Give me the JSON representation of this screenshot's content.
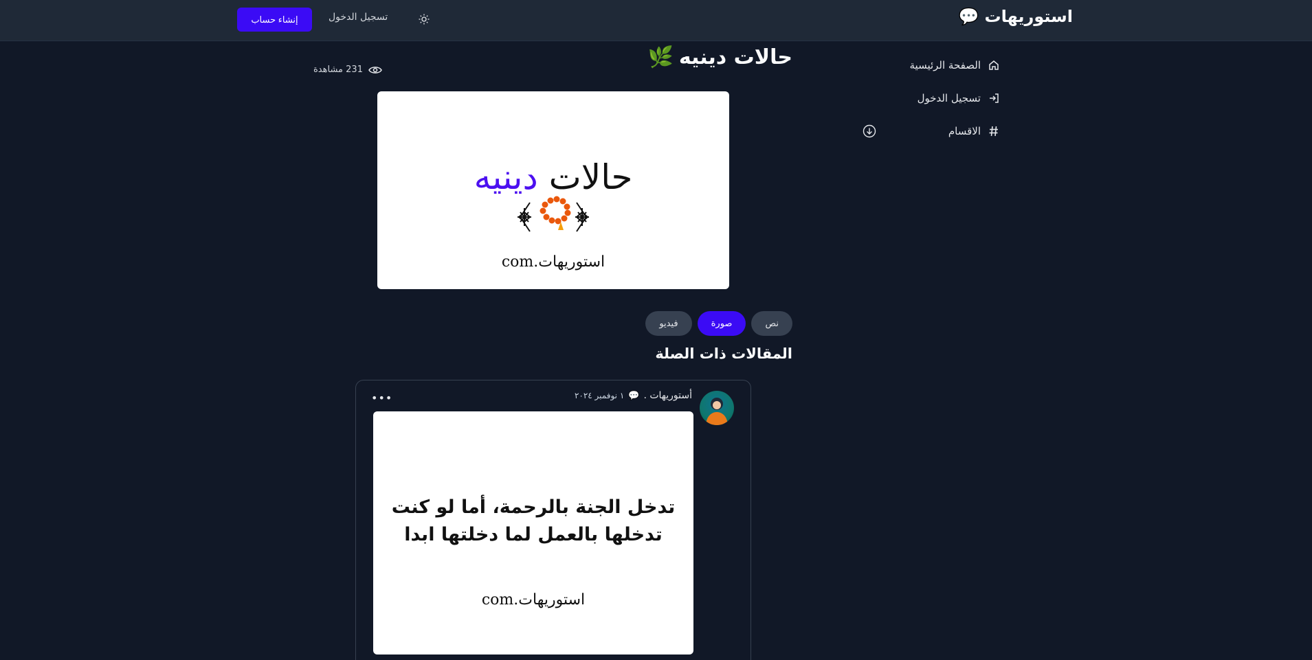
{
  "header": {
    "brand": "استوريهات",
    "brand_emoji": "💬",
    "signup_label": "إنشاء حساب",
    "login_label": "تسجيل الدخول",
    "theme_icon": "sun-icon",
    "brand_color": "#3b0bf5"
  },
  "sidebar": {
    "items": [
      {
        "label": "الصفحة الرئيسية",
        "icon": "home-icon"
      },
      {
        "label": "تسجيل الدخول",
        "icon": "login-icon"
      },
      {
        "label": "الاقسام",
        "icon": "hash-icon",
        "expand_icon": "chevron-down-circle-icon"
      }
    ]
  },
  "post": {
    "title": "حالات دينيه",
    "title_emoji": "🌿",
    "views": "231 مشاهدة",
    "hero": {
      "text_black": "حالات",
      "text_purple": "دينيه",
      "watermark": "استوريهات.com"
    },
    "tags": [
      {
        "label": "نص",
        "active": false
      },
      {
        "label": "صورة",
        "active": true
      },
      {
        "label": "فيديو",
        "active": false
      }
    ]
  },
  "related": {
    "heading": "المقالات ذات الصلة",
    "card": {
      "author": "أستوريهات .",
      "date": "١ نوفمبر ٢٠٢٤",
      "quote_line1": "تدخل الجنة بالرحمة، أما لو كنت",
      "quote_line2": "تدخلها بالعمل لما دخلتها ابدا",
      "watermark": "استوريهات.com",
      "more_icon": "more-horizontal-icon"
    }
  }
}
